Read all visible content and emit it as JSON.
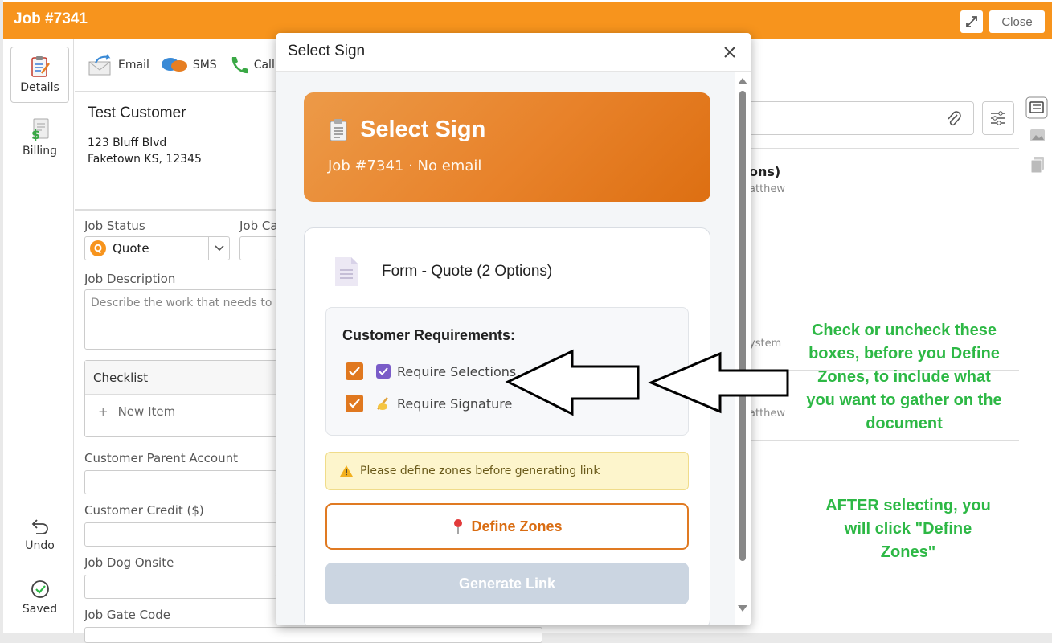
{
  "header": {
    "job_title": "Job #7341",
    "close_label": "Close"
  },
  "nav": {
    "details": "Details",
    "billing": "Billing",
    "undo": "Undo",
    "saved": "Saved"
  },
  "toolbar": {
    "email": "Email",
    "sms": "SMS",
    "call": "Call"
  },
  "customer": {
    "name": "Test Customer",
    "address1": "123 Bluff Blvd",
    "address2": "Faketown KS, 12345"
  },
  "form": {
    "job_status_label": "Job Status",
    "job_status_value": "Quote",
    "job_status_badge": "Q",
    "job_category_label": "Job Cat",
    "job_description_label": "Job Description",
    "job_description_placeholder": "Describe the work that needs to b",
    "checklist_label": "Checklist",
    "new_item_label": "New Item",
    "parent_account_label": "Customer Parent Account",
    "credit_label": "Customer Credit ($)",
    "dog_label": "Job Dog Onsite",
    "gate_label": "Job Gate Code"
  },
  "right_panel": {
    "item1_title": "ons)",
    "item1_sub": "atthew",
    "item2_sub": "ystem",
    "item3_sub": "atthew"
  },
  "modal": {
    "title": "Select Sign",
    "banner_title": "Select Sign",
    "banner_sub": "Job #7341 · No email",
    "form_name": "Form - Quote (2 Options)",
    "requirements_title": "Customer Requirements:",
    "require_selections": "Require Selections",
    "require_signature": "Require Signature",
    "require_selections_checked": true,
    "require_signature_checked": true,
    "warning": "Please define zones before generating link",
    "define_zones": "Define Zones",
    "generate_link": "Generate Link"
  },
  "annotation": {
    "note1": "Check or uncheck these boxes, before you Define Zones, to include what you want to gather on the document",
    "note2": "AFTER selecting, you will click \"Define Zones\""
  },
  "colors": {
    "header": "#f7941d",
    "accent": "#e0781f",
    "annotation": "#2db845",
    "disabled": "#cbd5e1"
  }
}
